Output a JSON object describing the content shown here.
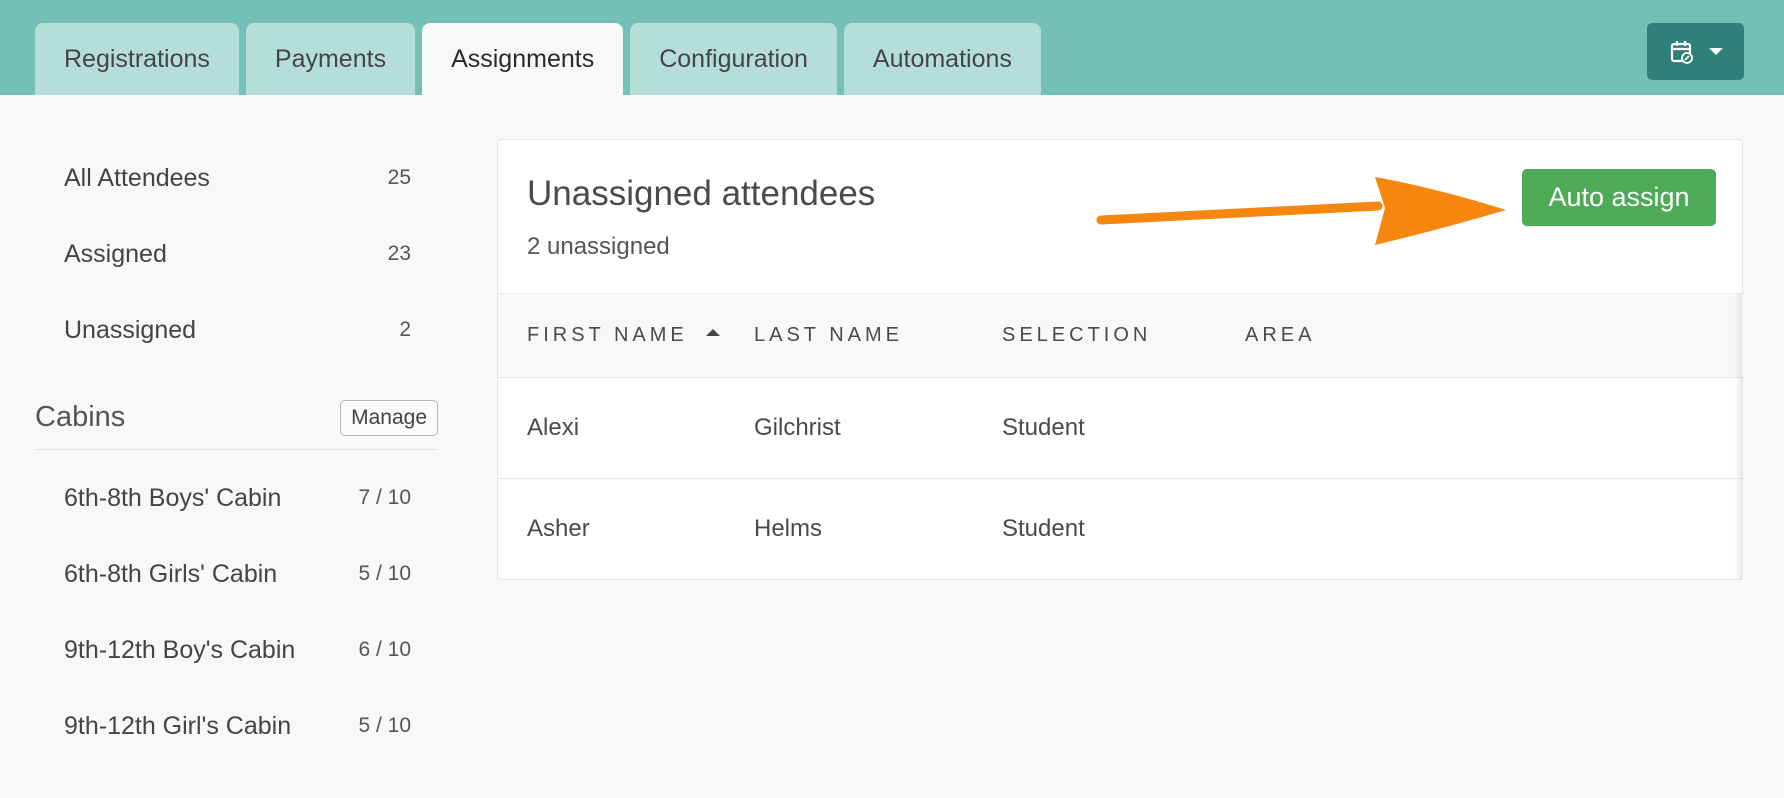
{
  "tabs": [
    {
      "label": "Registrations",
      "active": false
    },
    {
      "label": "Payments",
      "active": false
    },
    {
      "label": "Assignments",
      "active": true
    },
    {
      "label": "Configuration",
      "active": false
    },
    {
      "label": "Automations",
      "active": false
    }
  ],
  "header_button": {
    "icon": "calendar-link-icon"
  },
  "sidebar": {
    "filters": [
      {
        "label": "All Attendees",
        "count": "25"
      },
      {
        "label": "Assigned",
        "count": "23"
      },
      {
        "label": "Unassigned",
        "count": "2"
      }
    ],
    "cabins_title": "Cabins",
    "manage_label": "Manage",
    "cabins": [
      {
        "label": "6th-8th Boys' Cabin",
        "count": "7 / 10"
      },
      {
        "label": "6th-8th Girls' Cabin",
        "count": "5 / 10"
      },
      {
        "label": "9th-12th Boy's Cabin",
        "count": "6 / 10"
      },
      {
        "label": "9th-12th Girl's Cabin",
        "count": "5 / 10"
      }
    ]
  },
  "main": {
    "title": "Unassigned attendees",
    "subtitle": "2 unassigned",
    "auto_assign_label": "Auto assign",
    "annotation_color": "#f5870f",
    "columns": [
      "FIRST NAME",
      "LAST NAME",
      "SELECTION",
      "AREA"
    ],
    "sort_icon": "sort-ascending-icon",
    "rows": [
      {
        "first": "Alexi",
        "last": "Gilchrist",
        "selection": "Student",
        "area": ""
      },
      {
        "first": "Asher",
        "last": "Helms",
        "selection": "Student",
        "area": ""
      }
    ]
  },
  "colors": {
    "header_bg": "#74bfb8",
    "tab_bg": "#b5ddd9",
    "accent_button": "#4daa57",
    "calendar_button": "#2f8079"
  }
}
